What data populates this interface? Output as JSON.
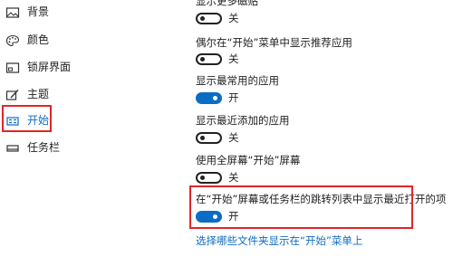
{
  "sidebar": {
    "items": [
      {
        "label": "背景",
        "icon": "picture-icon",
        "active": false
      },
      {
        "label": "颜色",
        "icon": "palette-icon",
        "active": false
      },
      {
        "label": "锁屏界面",
        "icon": "lock-screen-icon",
        "active": false
      },
      {
        "label": "主题",
        "icon": "theme-brush-icon",
        "active": false
      },
      {
        "label": "开始",
        "icon": "start-menu-icon",
        "active": true
      },
      {
        "label": "任务栏",
        "icon": "taskbar-icon",
        "active": false
      }
    ]
  },
  "settings": [
    {
      "label": "显示更多磁贴",
      "state": "关",
      "on": false
    },
    {
      "label": "偶尔在“开始”菜单中显示推荐应用",
      "state": "关",
      "on": false
    },
    {
      "label": "显示最常用的应用",
      "state": "开",
      "on": true
    },
    {
      "label": "显示最近添加的应用",
      "state": "关",
      "on": false
    },
    {
      "label": "使用全屏幕“开始”屏幕",
      "state": "关",
      "on": false
    },
    {
      "label": "在“开始”屏幕或任务栏的跳转列表中显示最近打开的项",
      "state": "开",
      "on": true
    }
  ],
  "link": {
    "label": "选择哪些文件夹显示在“开始”菜单上"
  },
  "colors": {
    "accent": "#0b6cc5",
    "highlight": "#e1262a"
  }
}
